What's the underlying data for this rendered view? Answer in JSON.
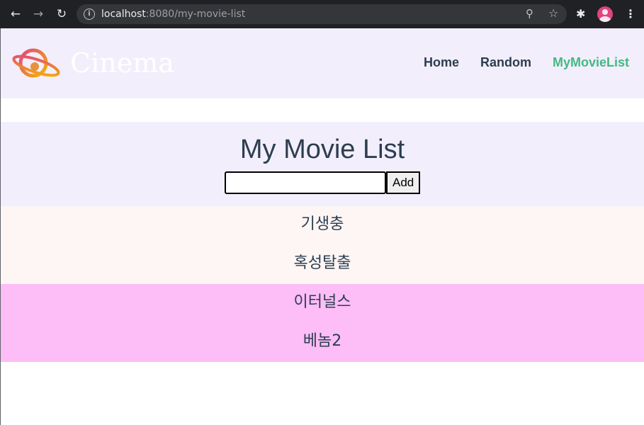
{
  "browser": {
    "url_host": "localhost",
    "url_path": ":8080/my-movie-list"
  },
  "navbar": {
    "brand": "Cinema",
    "links": [
      "Home",
      "Random",
      "MyMovieList"
    ],
    "active_link": "MyMovieList"
  },
  "main": {
    "title": "My Movie List",
    "input_value": "",
    "add_label": "Add",
    "movies": [
      "기생충",
      "혹성탈출",
      "이터널스",
      "베놈2"
    ]
  },
  "colors": {
    "nav_bg": "#f3eefb",
    "active_link": "#42b983",
    "row_light": "#fdf6f5",
    "row_pink": "#fdbdf7"
  }
}
